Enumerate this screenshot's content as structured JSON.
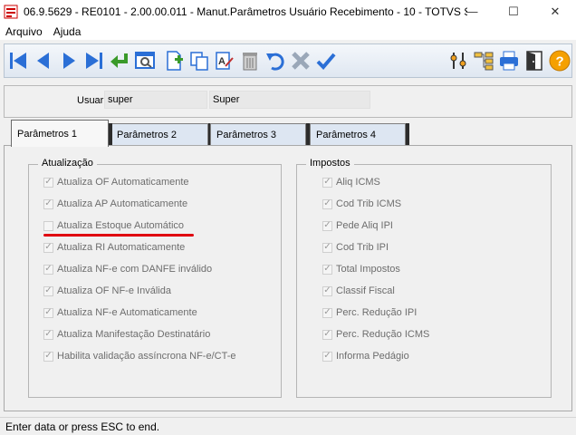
{
  "window": {
    "title": "06.9.5629 - RE0101 - 2.00.00.011 - Manut.Parâmetros Usuário Recebimento - 10 - TOTVS S...",
    "minimize": "—",
    "maximize": "☐",
    "close": "✕"
  },
  "menu": {
    "items": [
      "Arquivo",
      "Ajuda"
    ]
  },
  "toolbar": {
    "buttons": [
      "first-record",
      "previous-record",
      "next-record",
      "last-record",
      "go-to",
      "search",
      "new",
      "copy",
      "edit",
      "delete",
      "undo",
      "cancel",
      "save",
      "change-order",
      "related-programs",
      "print",
      "exit",
      "help"
    ]
  },
  "header": {
    "user_label": "Usuar:",
    "user_code": "super",
    "user_name": "Super"
  },
  "tabs": [
    "Parâmetros 1",
    "Parâmetros 2",
    "Parâmetros 3",
    "Parâmetros 4"
  ],
  "active_tab": 0,
  "atualizacao": {
    "title": "Atualização",
    "items": [
      {
        "label": "Atualiza OF Automaticamente",
        "checked": true
      },
      {
        "label": "Atualiza AP Automaticamente",
        "checked": true
      },
      {
        "label": "Atualiza Estoque Automático",
        "checked": false
      },
      {
        "label": "Atualiza RI Automaticamente",
        "checked": true
      },
      {
        "label": "Atualiza NF-e com DANFE inválido",
        "checked": true
      },
      {
        "label": "Atualiza OF NF-e Inválida",
        "checked": true
      },
      {
        "label": "Atualiza NF-e Automaticamente",
        "checked": true
      },
      {
        "label": "Atualiza Manifestação Destinatário",
        "checked": true
      },
      {
        "label": "Habilita validação assíncrona NF-e/CT-e",
        "checked": true
      }
    ]
  },
  "impostos": {
    "title": "Impostos",
    "items": [
      {
        "label": "Aliq ICMS",
        "checked": true
      },
      {
        "label": "Cod Trib ICMS",
        "checked": true
      },
      {
        "label": "Pede Aliq IPI",
        "checked": true
      },
      {
        "label": "Cod Trib IPI",
        "checked": true
      },
      {
        "label": "Total Impostos",
        "checked": true
      },
      {
        "label": "Classif Fiscal",
        "checked": true
      },
      {
        "label": "Perc. Redução IPI",
        "checked": true
      },
      {
        "label": "Perc. Redução ICMS",
        "checked": true
      },
      {
        "label": "Informa Pedágio",
        "checked": true
      }
    ]
  },
  "highlight": {
    "color": "#e00010"
  },
  "status": {
    "text": "Enter data or press ESC to end."
  }
}
